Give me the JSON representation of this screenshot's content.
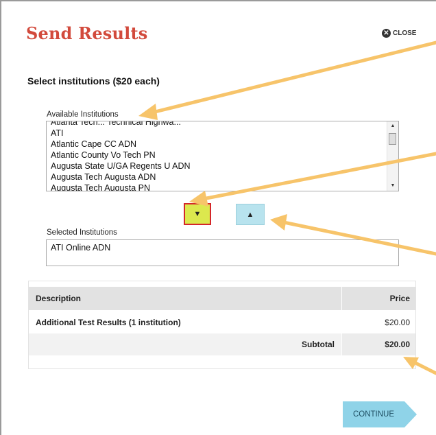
{
  "dialog": {
    "title": "Send Results",
    "close_label": "CLOSE"
  },
  "selection": {
    "heading": "Select institutions ($20 each)"
  },
  "available": {
    "label": "Available Institutions",
    "items": [
      "Atlanta Tech... Technical Highwa...",
      "ATI",
      "Atlantic Cape CC ADN",
      "Atlantic County Vo Tech PN",
      "Augusta State U/GA Regents U ADN",
      "Augusta Tech Augusta ADN",
      "Augusta Tech Augusta PN"
    ]
  },
  "move_buttons": {
    "down_icon": "triangle-down",
    "up_icon": "triangle-up",
    "down_color": "#dce84e",
    "up_color": "#b8e3ee"
  },
  "selected": {
    "label": "Selected Institutions",
    "items": [
      "ATI Online ADN"
    ]
  },
  "table": {
    "headers": [
      "Description",
      "Price"
    ],
    "rows": [
      {
        "description": "Additional Test Results (1 institution)",
        "price": "$20.00"
      }
    ],
    "subtotal_label": "Subtotal",
    "subtotal_value": "$20.00"
  },
  "continue_label": "CONTINUE",
  "colors": {
    "title": "#d24a3c",
    "callout_arrow": "#f7c46a",
    "continue": "#8fd3e8"
  }
}
